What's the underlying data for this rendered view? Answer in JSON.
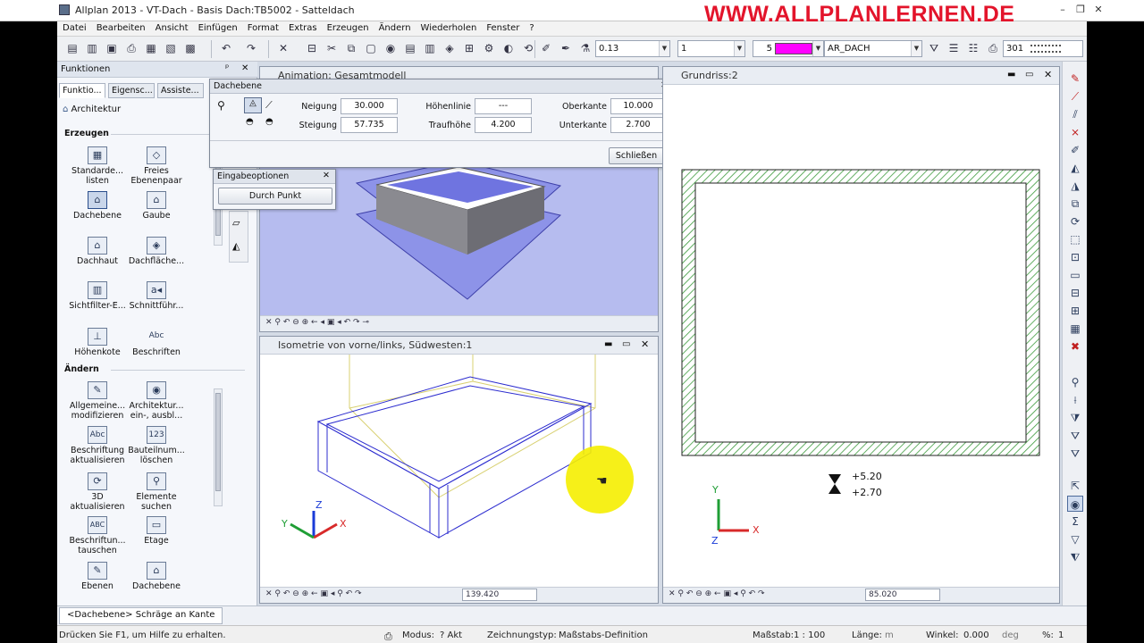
{
  "app": {
    "title": "Allplan 2013 - VT-Dach - Basis Dach:TB5002 - Satteldach",
    "brand": "WWW.ALLPLANLERNEN.DE"
  },
  "window_controls": {
    "minimize": "–",
    "restore": "❐",
    "close": "✕"
  },
  "menu": [
    "Datei",
    "Bearbeiten",
    "Ansicht",
    "Einfügen",
    "Format",
    "Extras",
    "Erzeugen",
    "Ändern",
    "Wiederholen",
    "Fenster",
    "?"
  ],
  "toolbar": {
    "pen_value": "0.13",
    "line_value": "1",
    "color_value": "5",
    "layer_value": "AR_DACH",
    "style_value": "301"
  },
  "panel": {
    "title": "Funktionen",
    "pin": "ᵖ",
    "close": "✕",
    "tabs": [
      "Funktio...",
      "Eigensc...",
      "Assiste..."
    ],
    "category": "Architektur",
    "section_create": "Erzeugen",
    "create_items": [
      {
        "label": "Standarde... listen",
        "icon": "▦"
      },
      {
        "label": "Freies Ebenenpaar",
        "icon": "◇"
      },
      {
        "label": "Dachebene",
        "icon": "⌂"
      },
      {
        "label": "Gaube",
        "icon": "⌂"
      },
      {
        "label": "Dachhaut",
        "icon": "⌂"
      },
      {
        "label": "Dachfläche...",
        "icon": "◈"
      },
      {
        "label": "Sichtfilter-E...",
        "icon": "▥"
      },
      {
        "label": "Schnittführ...",
        "icon": "a◂"
      },
      {
        "label": "Höhenkote",
        "icon": "⊥"
      },
      {
        "label": "Beschriften",
        "icon": "Abc"
      }
    ],
    "section_modify": "Ändern",
    "modify_items": [
      {
        "label": "Allgemeine... modifizieren",
        "icon": "✎"
      },
      {
        "label": "Architektur... ein-, ausbl...",
        "icon": "◉"
      },
      {
        "label": "Beschriftung aktualisieren",
        "icon": "Abc"
      },
      {
        "label": "Bauteilnum... löschen",
        "icon": "123"
      },
      {
        "label": "3D aktualisieren",
        "icon": "⟳"
      },
      {
        "label": "Elemente suchen",
        "icon": "⚲"
      },
      {
        "label": "Beschriftun... tauschen",
        "icon": "ABC"
      },
      {
        "label": "Etage",
        "icon": "▭"
      },
      {
        "label": "Ebenen",
        "icon": "✎"
      },
      {
        "label": "Dachebene",
        "icon": "⌂"
      }
    ]
  },
  "dialog_dachebene": {
    "title": "Dachebene",
    "neigung_label": "Neigung",
    "neigung_value": "30.000",
    "steigung_label": "Steigung",
    "steigung_value": "57.735",
    "hoehenlinie_label": "Höhenlinie",
    "hoehenlinie_value": "---",
    "traufhoehe_label": "Traufhöhe",
    "traufhoehe_value": "4.200",
    "oberkante_label": "Oberkante",
    "oberkante_value": "10.000",
    "unterkante_label": "Unterkante",
    "unterkante_value": "2.700",
    "close_button": "Schließen"
  },
  "dialog_eingabe": {
    "title": "Eingabeoptionen",
    "button": "Durch Punkt"
  },
  "views": {
    "animation_title": "Animation: Gesamtmodell",
    "iso_title": "Isometrie von vorne/links, Südwesten:1",
    "iso_zoom": "139.420",
    "grundriss_title": "Grundriss:2",
    "grundriss_zoom": "85.020",
    "level_top": "+5.20",
    "level_bottom": "+2.70",
    "axis_x": "X",
    "axis_y": "Y",
    "axis_z": "Z"
  },
  "bottom_tab": "<Dachebene> Schräge an Kante",
  "status": {
    "help": "Drücken Sie F1, um Hilfe zu erhalten.",
    "modus_label": "Modus:",
    "modus_value": "? Akt",
    "zeichnungstyp_label": "Zeichnungstyp:",
    "zeichnungstyp_value": "Maßstabs-Definition",
    "massstab_label": "Maßstab:",
    "massstab_value": "1 : 100",
    "laenge_label": "Länge:",
    "laenge_value": "m",
    "winkel_label": "Winkel:",
    "winkel_value": "0.000",
    "winkel_unit": "deg",
    "percent_label": "%:",
    "percent_value": "1"
  },
  "colors": {
    "brand": "#e3142b",
    "layer_swatch": "#ff00ff",
    "hatch": "#3c9a3c",
    "highlight": "#f5ee00"
  }
}
